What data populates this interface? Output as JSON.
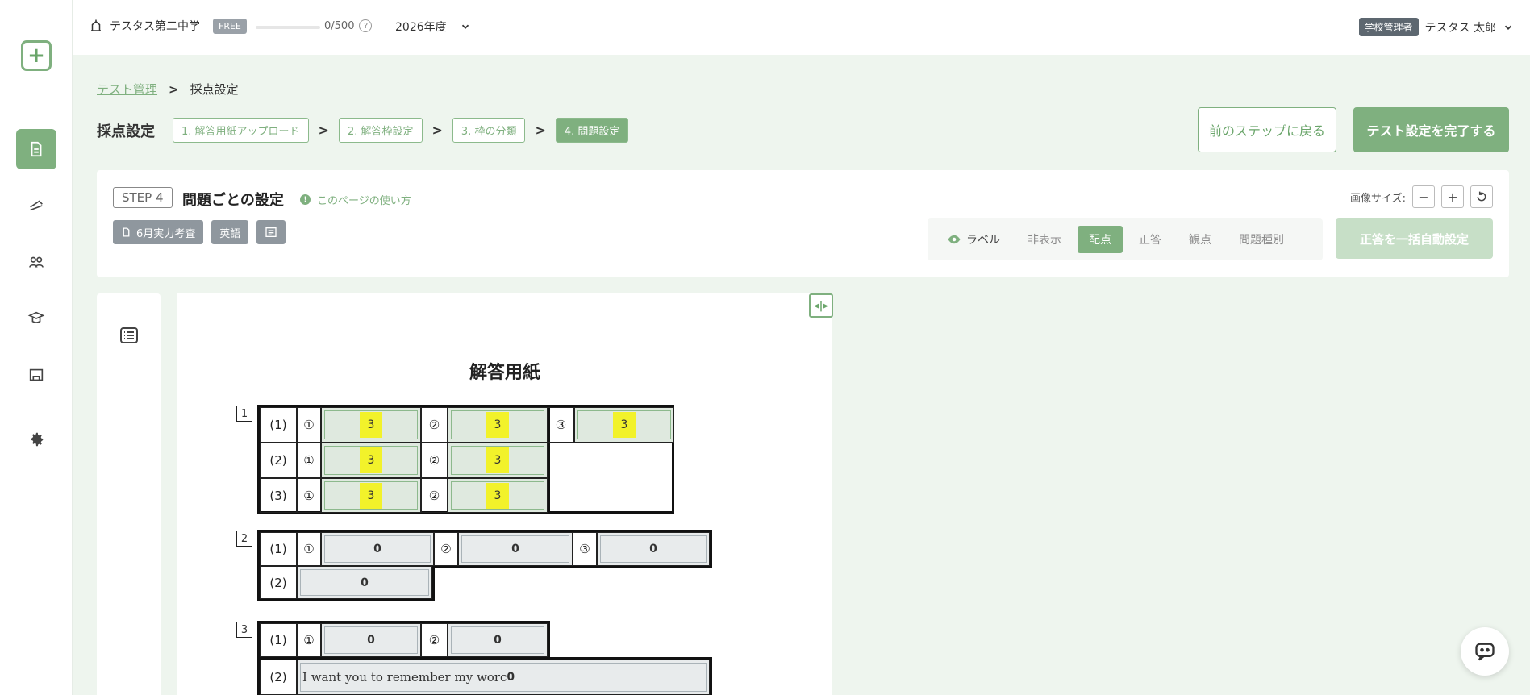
{
  "topbar": {
    "school_name": "テスタス第二中学",
    "plan": "FREE",
    "quota": "0/500",
    "quota_progress": 0,
    "help": "?",
    "year": "2026年度",
    "role": "学校管理者",
    "user_name": "テスタス 太郎"
  },
  "breadcrumb": {
    "parent": "テスト管理",
    "current": "採点設定"
  },
  "steps": {
    "title": "採点設定",
    "items": [
      "1. 解答用紙アップロード",
      "2. 解答枠設定",
      "3. 枠の分類",
      "4. 問題設定"
    ],
    "back_label": "前のステップに戻る",
    "finish_label": "テスト設定を完了する"
  },
  "card": {
    "step_badge": "STEP 4",
    "title": "問題ごとの設定",
    "howto": "このページの使い方",
    "tags": [
      "6月実力考査",
      "英語"
    ],
    "image_size_label": "画像サイズ:",
    "zoom_out": "−",
    "zoom_in": "+",
    "toggles": [
      "ラベル",
      "非表示",
      "配点",
      "正答",
      "観点",
      "問題種別"
    ],
    "active_toggle": "配点",
    "auto_label": "正答を一括自動設定"
  },
  "sheet": {
    "title": "解答用紙",
    "q1": {
      "num": "1",
      "rows": [
        "(1)",
        "(2)",
        "(3)"
      ],
      "marks": [
        "①",
        "②",
        "③"
      ],
      "scores": [
        "3",
        "3",
        "3",
        "3",
        "3",
        "3",
        "3"
      ]
    },
    "q2": {
      "num": "2",
      "rows": [
        "(1)",
        "(2)"
      ],
      "marks": [
        "①",
        "②",
        "③"
      ],
      "scores": [
        "0",
        "0",
        "0",
        "0"
      ]
    },
    "q3": {
      "num": "3",
      "rows": [
        "(1)",
        "(2)"
      ],
      "marks": [
        "①",
        "②"
      ],
      "scores": [
        "0",
        "0",
        "0"
      ],
      "text": "I want you to remember my worc"
    }
  },
  "colors": {
    "accent": "#7fb07f",
    "highlight": "#f2f22a"
  }
}
